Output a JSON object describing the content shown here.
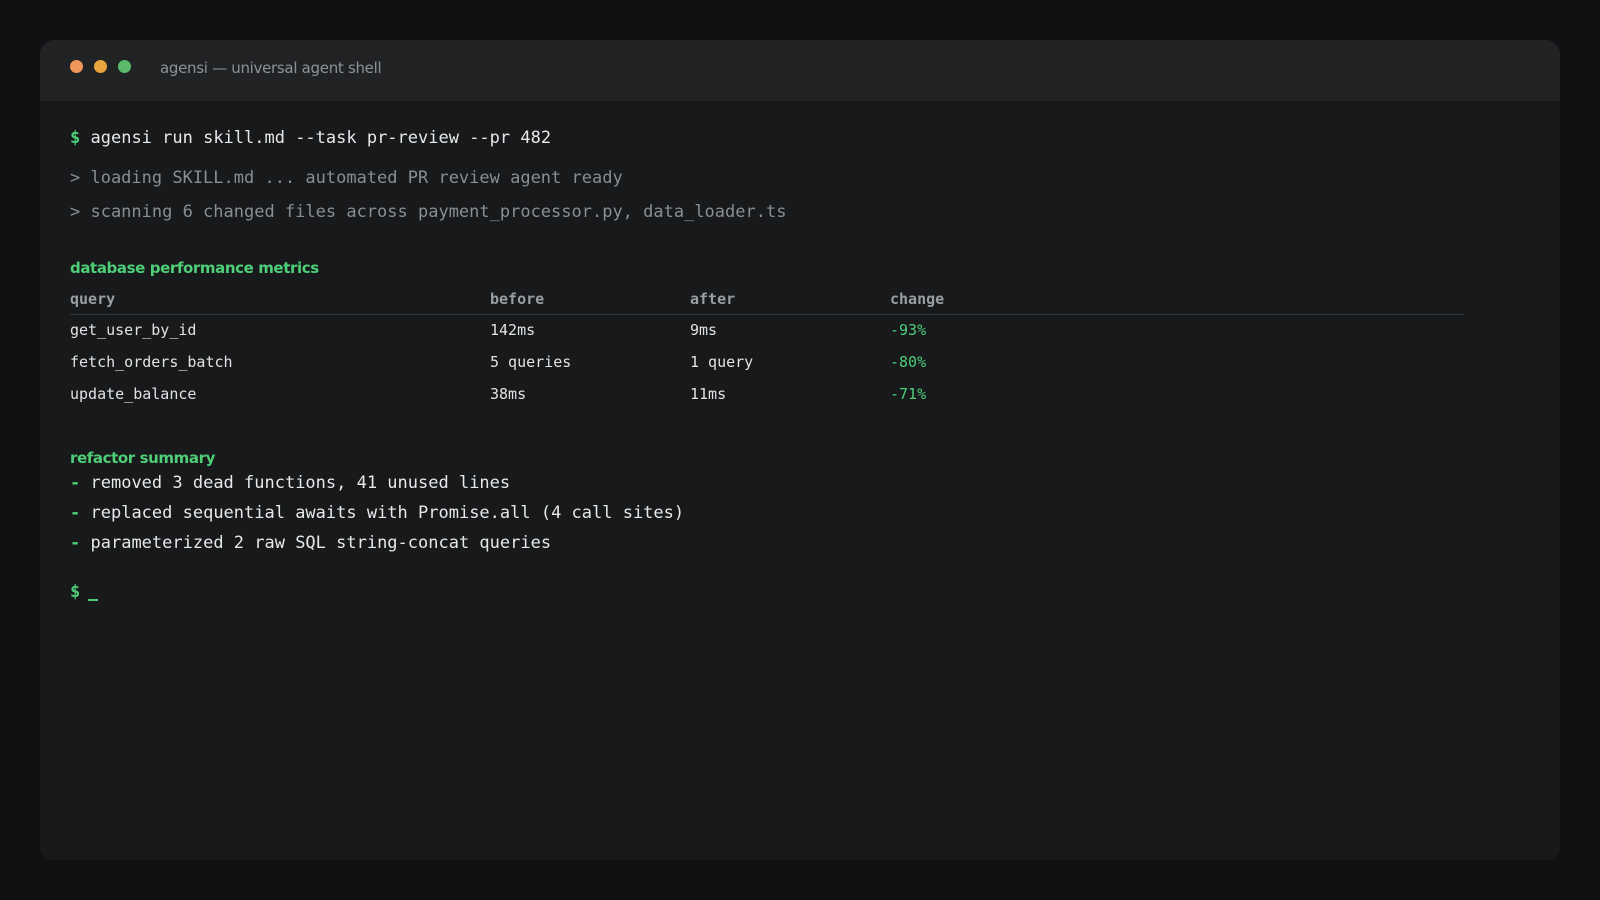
{
  "window": {
    "title": "agensi — universal agent shell"
  },
  "colors": {
    "accent": "#4fce78",
    "close": "#f0955b",
    "minimize": "#e8a53d",
    "maximize": "#5cba6a",
    "background": "#17191b"
  },
  "terminal": {
    "prompt_symbol": "$",
    "command": "agensi run skill.md --task pr-review --pr 482",
    "log_lines": [
      "> loading SKILL.md ... automated PR review agent ready",
      "> scanning 6 changed files across payment_processor.py, data_loader.ts"
    ],
    "metrics": {
      "title": "database performance metrics",
      "headers": [
        "query",
        "before",
        "after",
        "change"
      ],
      "rows": [
        [
          "get_user_by_id",
          "142ms",
          "9ms",
          "-93%"
        ],
        [
          "fetch_orders_batch",
          "5 queries",
          "1 query",
          "-80%"
        ],
        [
          "update_balance",
          "38ms",
          "11ms",
          "-71%"
        ]
      ]
    },
    "refactor": {
      "title": "refactor summary",
      "bullet_symbol": "-",
      "items": [
        "removed 3 dead functions, 41 unused lines",
        "replaced sequential awaits with Promise.all (4 call sites)",
        "parameterized 2 raw SQL string-concat queries"
      ]
    },
    "final_prompt_symbol": "$"
  }
}
